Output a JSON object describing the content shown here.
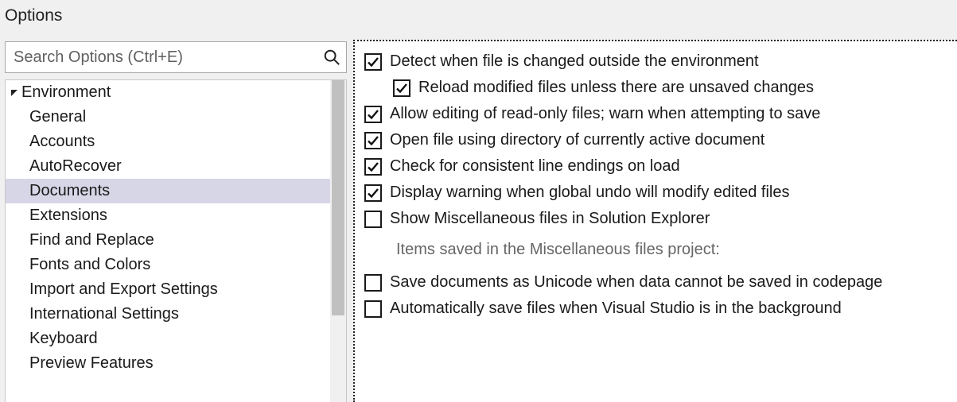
{
  "window": {
    "title": "Options"
  },
  "search": {
    "placeholder": "Search Options (Ctrl+E)"
  },
  "tree": {
    "group": "Environment",
    "expanded": true,
    "items": [
      {
        "label": "General",
        "selected": false
      },
      {
        "label": "Accounts",
        "selected": false
      },
      {
        "label": "AutoRecover",
        "selected": false
      },
      {
        "label": "Documents",
        "selected": true
      },
      {
        "label": "Extensions",
        "selected": false
      },
      {
        "label": "Find and Replace",
        "selected": false
      },
      {
        "label": "Fonts and Colors",
        "selected": false
      },
      {
        "label": "Import and Export Settings",
        "selected": false
      },
      {
        "label": "International Settings",
        "selected": false
      },
      {
        "label": "Keyboard",
        "selected": false
      },
      {
        "label": "Preview Features",
        "selected": false
      }
    ]
  },
  "options": [
    {
      "label": "Detect when file is changed outside the environment",
      "checked": true,
      "indent": 0
    },
    {
      "label": "Reload modified files unless there are unsaved changes",
      "checked": true,
      "indent": 1
    },
    {
      "label": "Allow editing of read-only files; warn when attempting to save",
      "checked": true,
      "indent": 0
    },
    {
      "label": "Open file using directory of currently active document",
      "checked": true,
      "indent": 0
    },
    {
      "label": "Check for consistent line endings on load",
      "checked": true,
      "indent": 0
    },
    {
      "label": "Display warning when global undo will modify edited files",
      "checked": true,
      "indent": 0
    },
    {
      "label": "Show Miscellaneous files in Solution Explorer",
      "checked": false,
      "indent": 0
    }
  ],
  "misc_section_label": "Items saved in the Miscellaneous files project:",
  "options2": [
    {
      "label": "Save documents as Unicode when data cannot be saved in codepage",
      "checked": false,
      "indent": 0
    },
    {
      "label": "Automatically save files when Visual Studio is in the background",
      "checked": false,
      "indent": 0
    }
  ]
}
